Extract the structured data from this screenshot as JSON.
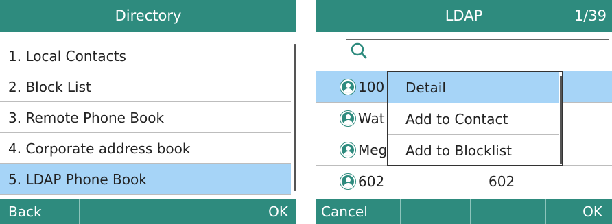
{
  "colors": {
    "accent": "#2e8b7e",
    "selection": "#a6d4f7"
  },
  "directory": {
    "title": "Directory",
    "items": [
      {
        "label": "1. Local Contacts"
      },
      {
        "label": "2. Block List"
      },
      {
        "label": "3. Remote Phone Book"
      },
      {
        "label": "4. Corporate address book"
      },
      {
        "label": "5. LDAP Phone Book",
        "selected": true
      }
    ],
    "softkeys": {
      "left": "Back",
      "right": "OK"
    }
  },
  "ldap": {
    "title": "LDAP",
    "counter": "1/39",
    "search": {
      "value": "",
      "icon": "search-icon"
    },
    "contacts": [
      {
        "name": "100",
        "number": "",
        "selected": true
      },
      {
        "name": "Wat",
        "number": ""
      },
      {
        "name": "Meg",
        "number": ""
      },
      {
        "name": "602",
        "number": "602"
      }
    ],
    "popup": {
      "items": [
        {
          "label": "Detail",
          "selected": true
        },
        {
          "label": "Add to Contact"
        },
        {
          "label": "Add to Blocklist"
        }
      ]
    },
    "softkeys": {
      "left": "Cancel",
      "right": "OK"
    }
  }
}
